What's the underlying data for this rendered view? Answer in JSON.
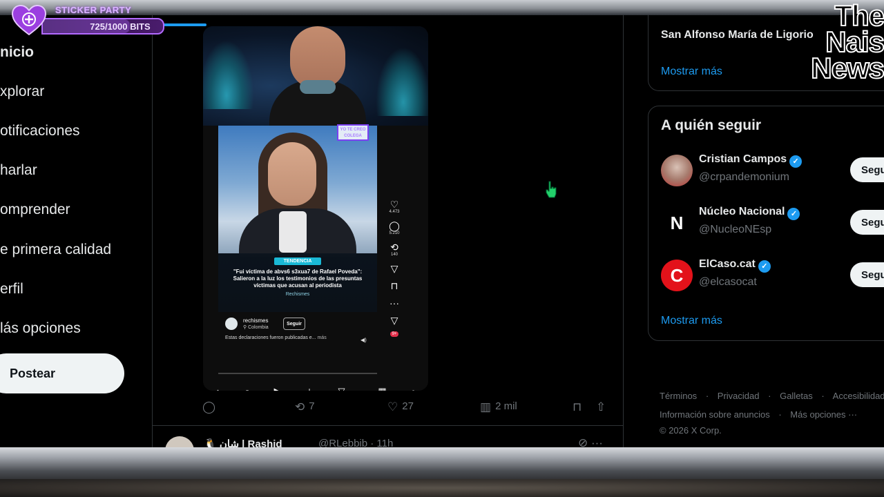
{
  "nav": {
    "items": [
      {
        "label": "nicio",
        "bold": true
      },
      {
        "label": "xplorar"
      },
      {
        "label": "otificaciones"
      },
      {
        "label": "harlar"
      },
      {
        "label": "omprender"
      },
      {
        "label": "e primera calidad"
      },
      {
        "label": "erfil"
      },
      {
        "label": "lás opciones"
      }
    ],
    "post_label": "Postear"
  },
  "overlay": {
    "sticker_title": "STICKER PARTY",
    "sticker_bits": "725/1000 BITS",
    "sticker_progress": 0.725,
    "logo_lines": [
      "The",
      "Nais",
      "News"
    ]
  },
  "video": {
    "inner": {
      "brand_box": "YO TE CREO COLEGA",
      "tag": "TENDENCIA",
      "headline": "\"Fui víctima de abvs6 s3xua7 de Rafael Poveda\": Salieron a la luz los testimonios de las presuntas víctimas que acusan al periodista",
      "brand": "Rechismes",
      "actions": [
        {
          "icon": "heart-icon",
          "glyph": "♡",
          "count": "4.473"
        },
        {
          "icon": "comment-icon",
          "glyph": "◯",
          "count": "5.210"
        },
        {
          "icon": "repost-icon",
          "glyph": "⟲",
          "count": "140"
        },
        {
          "icon": "share-icon",
          "glyph": "▽",
          "count": ""
        },
        {
          "icon": "bookmark-icon",
          "glyph": "⊓",
          "count": ""
        },
        {
          "icon": "more-icon",
          "glyph": "···",
          "count": ""
        }
      ],
      "notif_badge": "9+",
      "poster_name": "rechismes",
      "poster_location": "Colombia",
      "poster_follow": "Seguir",
      "poster_desc": "Estas declaraciones fueron publicadas e... ",
      "poster_more": "más"
    },
    "bottom_badge": "9+"
  },
  "tweet": {
    "repost_count": "7",
    "like_count": "27",
    "views": "2 mil"
  },
  "next_tweet": {
    "name": "🐧 شان | Rashid",
    "handle": "@RLebbib · 11h"
  },
  "right": {
    "trend_title": "San Alfonso María de Ligorio",
    "show_more": "Mostrar más",
    "who_title": "A quién seguir",
    "who": [
      {
        "name": "Cristian Campos",
        "handle": "@crpandemonium",
        "button": "Seguir",
        "avatar_color": "#b83232"
      },
      {
        "name": "Núcleo Nacional",
        "handle": "@NucleoNEsp",
        "button": "Seguir",
        "avatar_color": "#000000"
      },
      {
        "name": "ElCaso.cat",
        "handle": "@elcasocat",
        "button": "Seguir",
        "avatar_color": "#e3121a"
      }
    ],
    "who_show_more": "Mostrar más",
    "footer": {
      "row1": [
        "Términos",
        "·",
        "Privacidad",
        "·",
        "Galletas",
        "·",
        "Accesibilidad"
      ],
      "row2": [
        "Información sobre anuncios",
        "·",
        "Más opciones ···"
      ],
      "row3": "© 2026 X Corp."
    }
  },
  "colors": {
    "accent": "#1d9bf0",
    "sticker_purple": "#b36bff"
  }
}
